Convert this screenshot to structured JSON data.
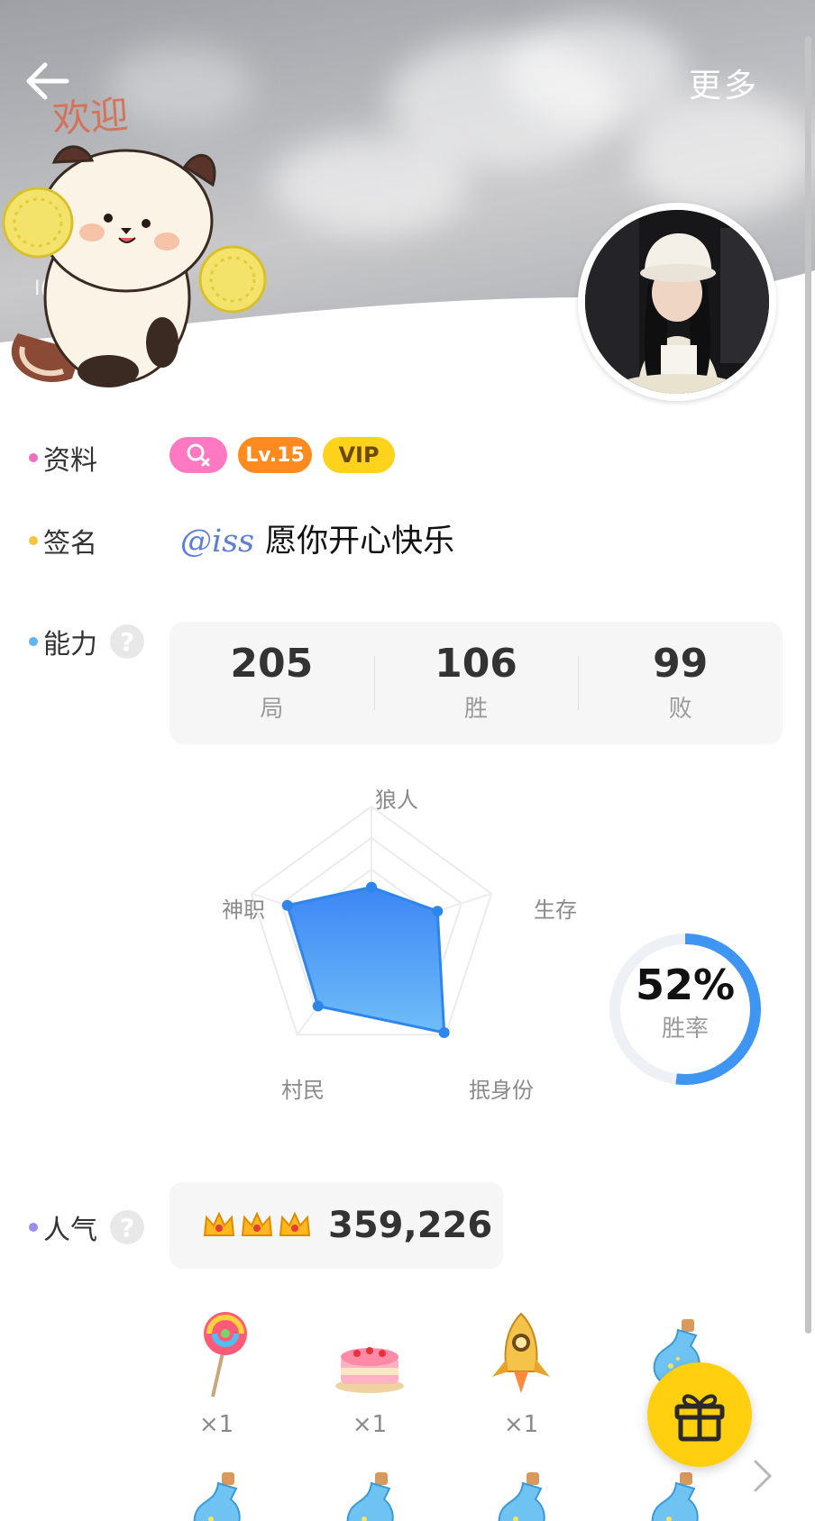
{
  "header": {
    "more_label": "更多",
    "banner_text": "欢迎",
    "banner_edge_text": "I("
  },
  "profile": {
    "label": "资料",
    "badges": {
      "level": "Lv.15",
      "vip": "VIP"
    }
  },
  "signature": {
    "label": "签名",
    "mention": "@iss",
    "text": "愿你开心快乐"
  },
  "ability": {
    "label": "能力",
    "help": "?",
    "stats": [
      {
        "value": "205",
        "label": "局"
      },
      {
        "value": "106",
        "label": "胜"
      },
      {
        "value": "99",
        "label": "败"
      }
    ],
    "radar_axes": [
      "狼人",
      "生存",
      "抿身份",
      "村民",
      "神职"
    ],
    "radar_values": [
      0.36,
      0.55,
      0.98,
      0.72,
      0.7
    ],
    "win_rate": {
      "value": "52%",
      "label": "胜率",
      "fraction": 0.52
    }
  },
  "popularity": {
    "label": "人气",
    "help": "?",
    "value": "359,226"
  },
  "gifts": [
    {
      "icon": "lollipop-icon",
      "count": "×1"
    },
    {
      "icon": "cake-icon",
      "count": "×1"
    },
    {
      "icon": "rocket-icon",
      "count": "×1"
    },
    {
      "icon": "potion-icon",
      "count": ""
    }
  ],
  "colors": {
    "accent_blue": "#3f95f2",
    "dot_profile": "#f06dc4",
    "dot_signature": "#f5c63a",
    "dot_ability": "#5fb4f2",
    "dot_popularity": "#9b8cf0"
  }
}
